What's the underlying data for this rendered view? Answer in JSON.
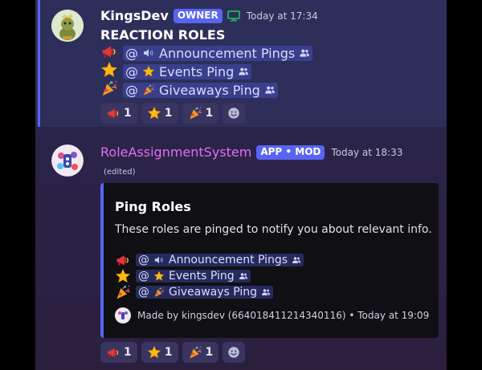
{
  "msg1": {
    "username": "KingsDev",
    "username_color": "#ffffff",
    "tag": "OWNER",
    "status_icon": "monitor-icon",
    "timestamp": "Today at 17:34",
    "title": "REACTION ROLES",
    "roles": [
      {
        "emoji_icon": "megaphone-icon",
        "mention_prefix": "@",
        "mention_icon": "speaker-icon",
        "label": "Announcement Pings"
      },
      {
        "emoji_icon": "star-icon",
        "mention_prefix": "@",
        "mention_icon": "star-icon",
        "label": "Events Ping"
      },
      {
        "emoji_icon": "party-popper-icon",
        "mention_prefix": "@",
        "mention_icon": "party-popper-icon",
        "label": "Giveaways Ping"
      }
    ],
    "reactions": [
      {
        "icon": "megaphone-icon",
        "count": "1"
      },
      {
        "icon": "star-icon",
        "count": "1"
      },
      {
        "icon": "party-popper-icon",
        "count": "1"
      }
    ]
  },
  "msg2": {
    "username": "RoleAssignmentSystem",
    "username_color": "#e36cf5",
    "tag": "APP • MOD",
    "timestamp": "Today at 18:33",
    "edited": "(edited)",
    "embed": {
      "title": "Ping Roles",
      "description": "These roles are pinged to notify you about relevant info.",
      "roles": [
        {
          "emoji_icon": "megaphone-icon",
          "mention_prefix": "@",
          "mention_icon": "speaker-icon",
          "label": "Announcement Pings"
        },
        {
          "emoji_icon": "star-icon",
          "mention_prefix": "@",
          "mention_icon": "star-icon",
          "label": "Events Ping"
        },
        {
          "emoji_icon": "party-popper-icon",
          "mention_prefix": "@",
          "mention_icon": "party-popper-icon",
          "label": "Giveaways Ping"
        }
      ],
      "footer": "Made by kingsdev (664018411214340116) • Today at 19:09",
      "accent_color": "#5865f2"
    },
    "reactions": [
      {
        "icon": "megaphone-icon",
        "count": "1"
      },
      {
        "icon": "star-icon",
        "count": "1"
      },
      {
        "icon": "party-popper-icon",
        "count": "1"
      }
    ]
  },
  "colors": {
    "accent": "#5865f2",
    "mention_bg": "#3b3f7a",
    "status_green": "#23a55a"
  }
}
